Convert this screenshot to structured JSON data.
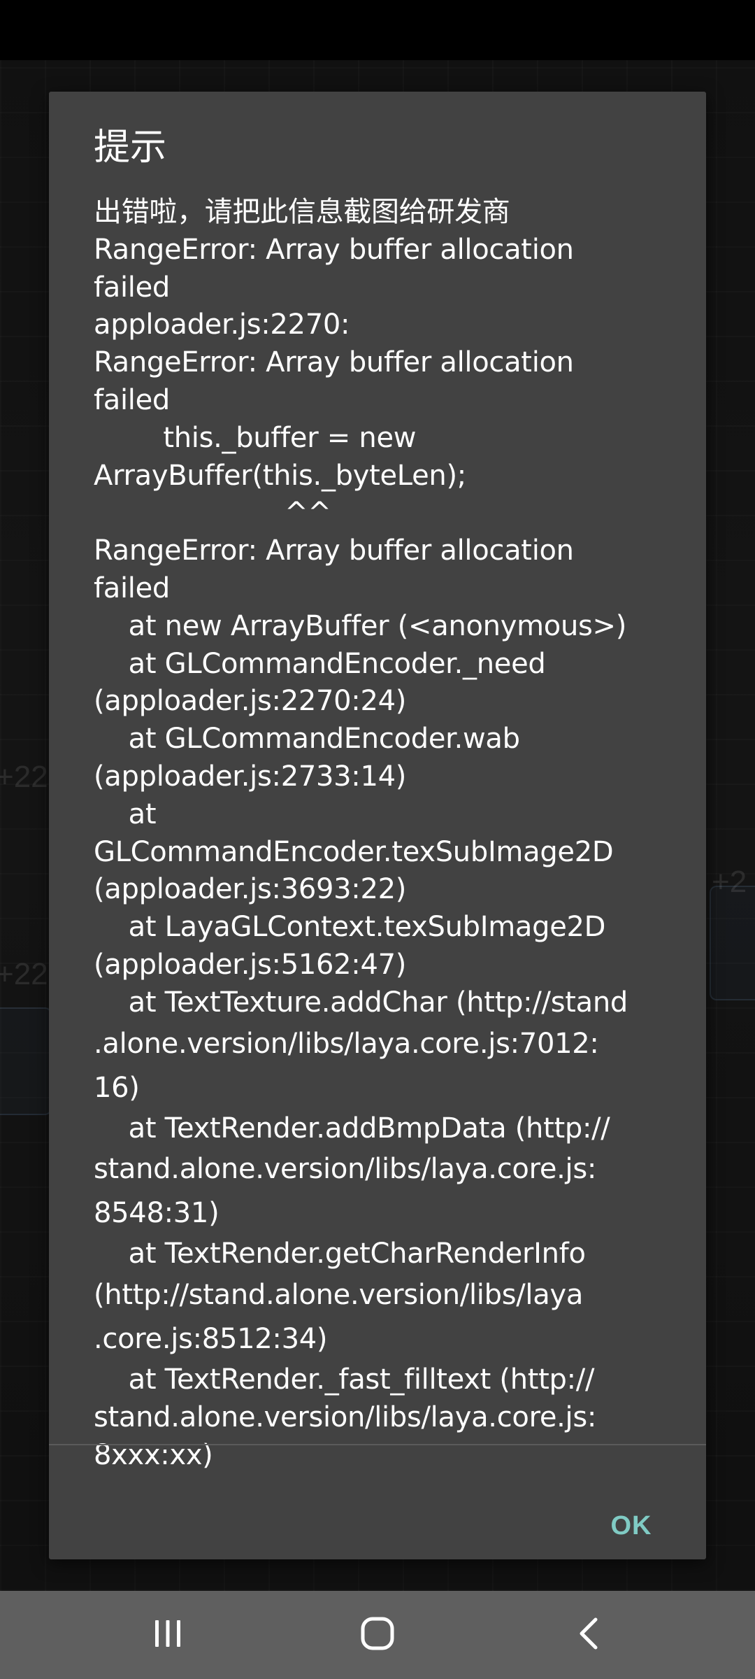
{
  "dialog": {
    "title": "提示",
    "message_lines": [
      "出错啦，请把此信息截图给研发商",
      "RangeError: Array buffer allocation",
      "failed",
      "apploader.js:2270:",
      "RangeError: Array buffer allocation",
      "failed",
      "        this._buffer = new",
      "ArrayBuffer(this._byteLen);",
      "                      ^^",
      "RangeError: Array buffer allocation",
      "failed",
      "    at new ArrayBuffer (<anonymous>)",
      "    at GLCommandEncoder._need",
      "(apploader.js:2270:24)",
      "    at GLCommandEncoder.wab",
      "(apploader.js:2733:14)",
      "    at",
      "GLCommandEncoder.texSubImage2D",
      "(apploader.js:3693:22)",
      "    at LayaGLContext.texSubImage2D",
      "(apploader.js:5162:47)",
      "    at TextTexture.addChar (http://stand",
      ".alone.version/libs/laya.core.js:7012:",
      "16)",
      "    at TextRender.addBmpData (http://",
      "stand.alone.version/libs/laya.core.js:",
      "8548:31)",
      "    at TextRender.getCharRenderInfo",
      "(http://stand.alone.version/libs/laya",
      ".core.js:8512:34)",
      "    at TextRender._fast_filltext (http://",
      "stand.alone.version/libs/laya.core.js:",
      "8xxx:xx)"
    ],
    "ok_label": "OK"
  },
  "nav_bar": {
    "recents_icon": "recents-icon",
    "home_icon": "home-icon",
    "back_icon": "back-icon"
  },
  "colors": {
    "dialog_bg": "#424242",
    "accent": "#80cbc4",
    "nav_bg": "#5f5f5f"
  }
}
